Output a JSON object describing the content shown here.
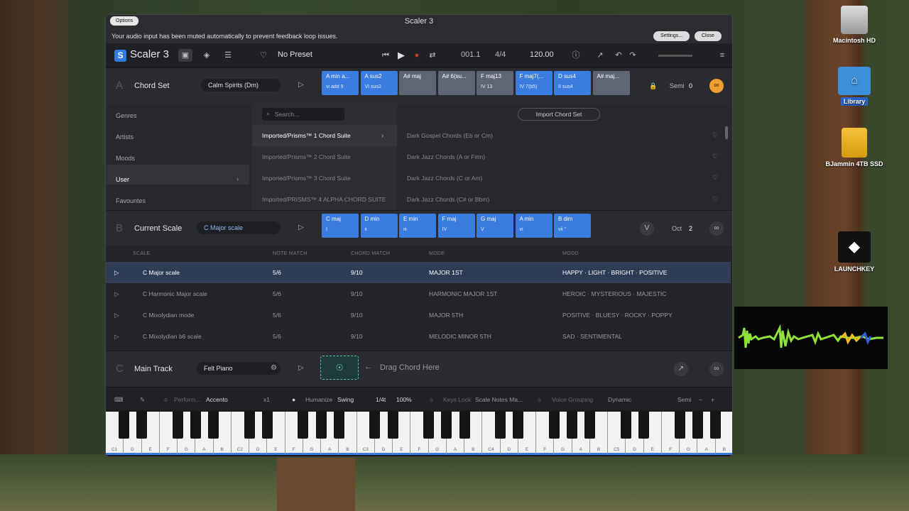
{
  "desktop": {
    "icons": [
      {
        "label": "Macintosh HD",
        "icon": "hard-drive-icon"
      },
      {
        "label": "Library",
        "icon": "folder-icon"
      },
      {
        "label": "BJammin 4TB SSD",
        "icon": "external-drive-icon"
      },
      {
        "label": "LAUNCHKEY",
        "icon": "launchkey-icon"
      }
    ]
  },
  "window": {
    "title": "Scaler 3",
    "options_label": "Options",
    "notice": "Your audio input has been muted automatically to prevent feedback loop issues.",
    "settings_label": "Settings...",
    "close_label": "Close"
  },
  "toolbar": {
    "app_name": "Scaler 3",
    "logo_letter": "S",
    "preset": "No Preset",
    "position": "001.1",
    "signature": "4/4",
    "tempo": "120.00"
  },
  "chord_set": {
    "letter": "A",
    "name": "Chord Set",
    "selector": "Calm Spirits (Dm)",
    "chips": [
      {
        "name": "A min a...",
        "roman": "vi add 9",
        "style": "blue"
      },
      {
        "name": "A sus2",
        "roman": "VI sus2",
        "style": "blue"
      },
      {
        "name": "A# maj",
        "roman": "",
        "style": "gray"
      },
      {
        "name": "A# 6(su...",
        "roman": "",
        "style": "gray"
      },
      {
        "name": "F maj13",
        "roman": "IV 13",
        "style": "gray"
      },
      {
        "name": "F maj7(...",
        "roman": "IV 7(b5)",
        "style": "blue"
      },
      {
        "name": "D sus4",
        "roman": "II sus4",
        "style": "blue"
      },
      {
        "name": "A# maj...",
        "roman": "",
        "style": "gray"
      }
    ],
    "semi_label": "Semi",
    "semi_value": "0"
  },
  "browser": {
    "nav": [
      "Genres",
      "Artists",
      "Moods",
      "User",
      "Favourites"
    ],
    "search_placeholder": "Search...",
    "import_label": "Import Chord Set",
    "suites": [
      "Imported/Prisms™ 1 Chord Suite",
      "Imported/Prisms™ 2 Chord Suite",
      "Imported/Prisms™ 3 Chord Suite",
      "Imported/PRISMS™ 4 ALPHA CHORD SUITE"
    ],
    "sets": [
      "Dark Gospel Chords (Eb or Cm)",
      "Dark Jazz Chords (A or F#m)",
      "Dark Jazz Chords (C or Am)",
      "Dark Jazz Chords (C# or Bbm)"
    ]
  },
  "current_scale": {
    "letter": "B",
    "name": "Current Scale",
    "selector": "C Major scale",
    "chips": [
      {
        "name": "C maj",
        "roman": "I"
      },
      {
        "name": "D min",
        "roman": "ii"
      },
      {
        "name": "E min",
        "roman": "iii"
      },
      {
        "name": "F maj",
        "roman": "IV"
      },
      {
        "name": "G maj",
        "roman": "V"
      },
      {
        "name": "A min",
        "roman": "vi"
      },
      {
        "name": "B dim",
        "roman": "vii °"
      }
    ],
    "oct_label": "Oct",
    "oct_value": "2"
  },
  "scale_table": {
    "headers": [
      "SCALE",
      "NOTE MATCH",
      "CHORD MATCH",
      "MODE",
      "MOOD"
    ],
    "rows": [
      {
        "scale": "C Major scale",
        "note": "5/6",
        "chord": "9/10",
        "mode": "MAJOR  1ST",
        "mood": "HAPPY · LIGHT · BRIGHT · POSITIVE"
      },
      {
        "scale": "C Harmonic Major scale",
        "note": "5/6",
        "chord": "9/10",
        "mode": "HARMONIC MAJOR  1ST",
        "mood": "HEROIC · MYSTERIOUS · MAJESTIC"
      },
      {
        "scale": "C Mixolydian mode",
        "note": "5/6",
        "chord": "9/10",
        "mode": "MAJOR  5TH",
        "mood": "POSITIVE · BLUESY · ROCKY · POPPY"
      },
      {
        "scale": "C Mixolydian b6 scale",
        "note": "5/6",
        "chord": "9/10",
        "mode": "MELODIC MINOR  5TH",
        "mood": "SAD · SENTIMENTAL"
      }
    ]
  },
  "main_track": {
    "letter": "C",
    "name": "Main Track",
    "instrument": "Felt Piano",
    "drag_hint": "Drag Chord Here"
  },
  "bottom_bar": {
    "perform_label": "Perform...",
    "accento": "Accento",
    "multiplier": "x1",
    "humanize": "Humanize",
    "swing": "Swing",
    "division": "1/4t",
    "percent": "100%",
    "keys_lock": "Keys Lock",
    "scale_notes": "Scale Notes Ma...",
    "voice_grouping": "Voice Grouping",
    "dynamic": "Dynamic",
    "semi": "Semi",
    "minus": "−",
    "plus": "+"
  },
  "piano": {
    "keys": [
      "C1",
      "D",
      "E",
      "F",
      "G",
      "A",
      "B",
      "C2",
      "D",
      "E",
      "F",
      "G",
      "A",
      "B",
      "C3",
      "D",
      "E",
      "F",
      "G",
      "A",
      "B",
      "C4",
      "D",
      "E",
      "F",
      "G",
      "A",
      "B",
      "C5",
      "D",
      "E",
      "F",
      "G",
      "A",
      "B"
    ]
  },
  "colors": {
    "accent": "#3a7ce0",
    "link_orange": "#f0a030",
    "selected_row": "#2d3d55"
  }
}
